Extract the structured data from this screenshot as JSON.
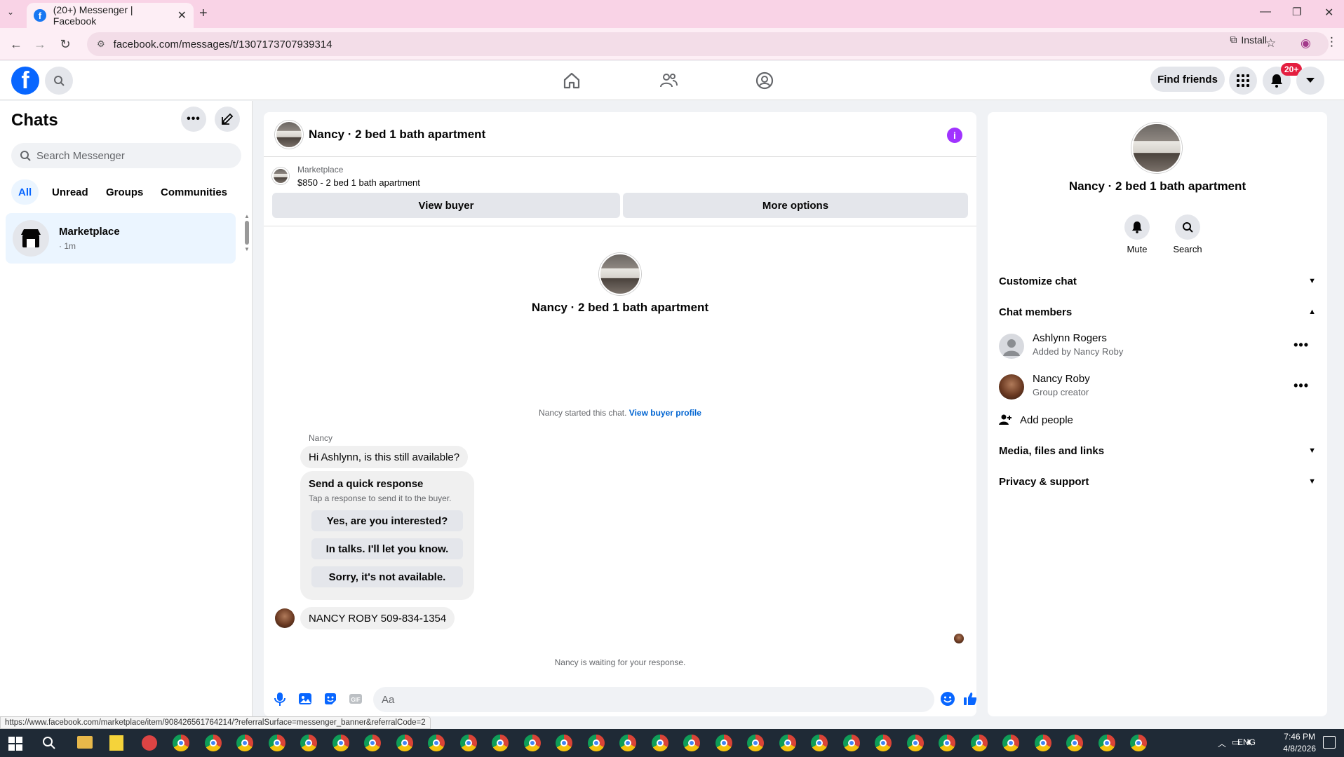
{
  "browser": {
    "tab_title": "(20+) Messenger | Facebook",
    "url": "facebook.com/messages/t/1307173707939314",
    "install_label": "Install",
    "status_url": "https://www.facebook.com/marketplace/item/908426561764214/?referralSurface=messenger_banner&referralCode=2"
  },
  "header": {
    "find_friends": "Find friends",
    "notif_badge": "20+"
  },
  "sidebar": {
    "title": "Chats",
    "search_placeholder": "Search Messenger",
    "filters": [
      "All",
      "Unread",
      "Groups",
      "Communities"
    ],
    "active_filter": "All",
    "chat": {
      "name": "Marketplace",
      "time": "· 1m"
    }
  },
  "conversation": {
    "title": "Nancy · 2 bed 1 bath apartment",
    "marketplace_label": "Marketplace",
    "listing": "$850 - 2 bed 1 bath apartment",
    "view_buyer": "View buyer",
    "more_options": "More options",
    "center_title": "Nancy · 2 bed 1 bath apartment",
    "started_text": "Nancy started this chat.",
    "view_buyer_profile": "View buyer profile",
    "sender_name": "Nancy",
    "message1": "Hi Ashlynn, is this still available?",
    "quick_title": "Send a quick response",
    "quick_sub": "Tap a response to send it to the buyer.",
    "quick_responses": [
      "Yes, are you interested?",
      "In talks. I'll let you know.",
      "Sorry, it's not available."
    ],
    "message2": "NANCY ROBY 509-834-1354",
    "waiting": "Nancy is waiting for your response.",
    "input_placeholder": "Aa"
  },
  "details": {
    "title": "Nancy · 2 bed 1 bath apartment",
    "mute": "Mute",
    "search": "Search",
    "customize_chat": "Customize chat",
    "chat_members": "Chat members",
    "members": [
      {
        "name": "Ashlynn Rogers",
        "sub": "Added by Nancy Roby"
      },
      {
        "name": "Nancy Roby",
        "sub": "Group creator"
      }
    ],
    "add_people": "Add people",
    "media": "Media, files and links",
    "privacy": "Privacy & support"
  },
  "taskbar": {
    "lang": "ENG",
    "time": "7:46 PM",
    "date": "4/8/2026"
  },
  "colors": {
    "accent": "#0866ff",
    "info": "#a033ff",
    "badge": "#e41e3f"
  }
}
